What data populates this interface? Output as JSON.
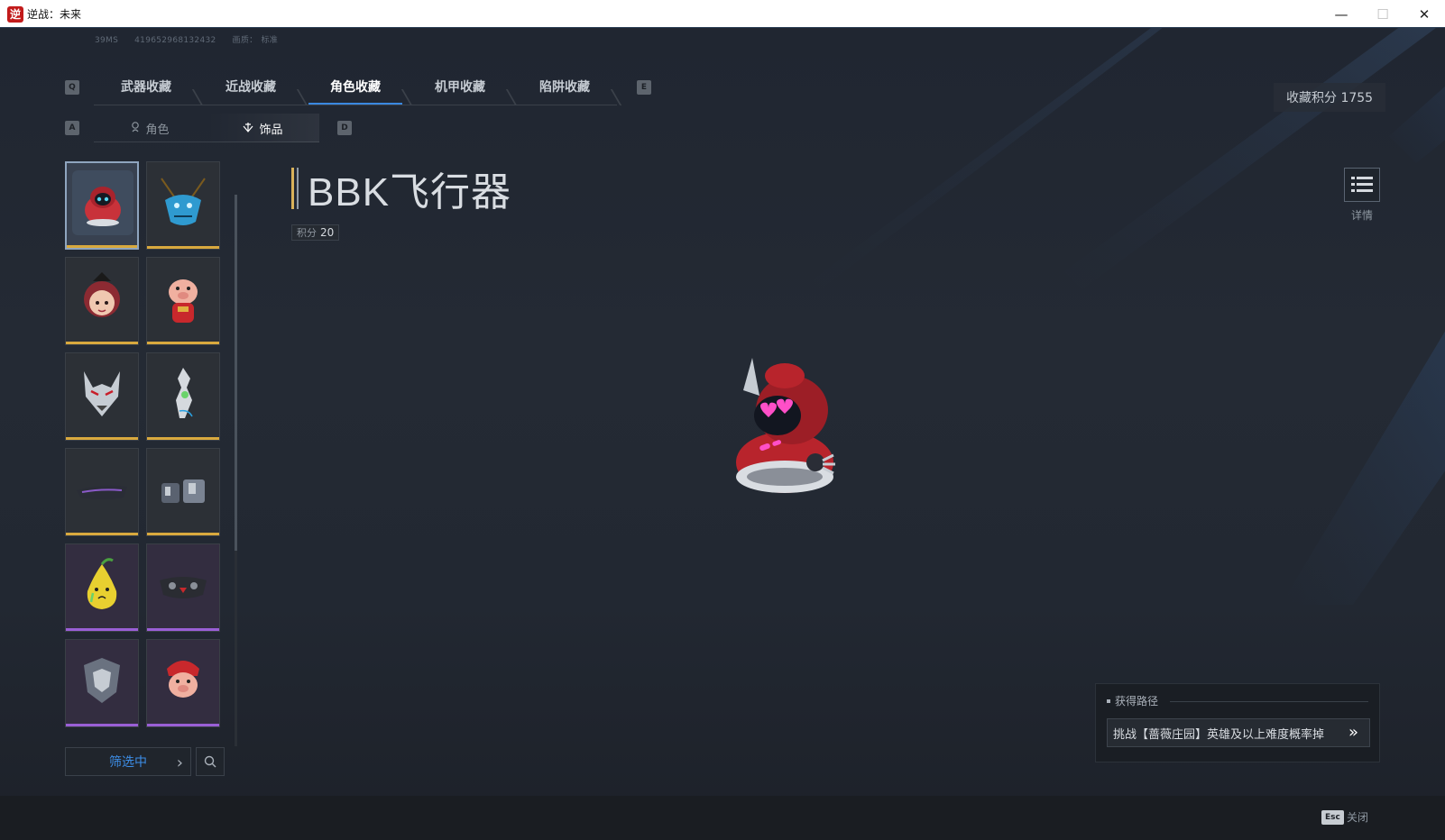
{
  "window": {
    "title": "逆战：未来",
    "minimize": "—",
    "maximize": "☐",
    "close": "✕"
  },
  "netinfo": {
    "ping": "39MS",
    "id": "419652968132432",
    "quality_label": "画质：",
    "quality_value": "标准"
  },
  "key_hints": {
    "prev_tab": "Q",
    "next_tab": "E",
    "prev_sub": "A",
    "next_sub": "D"
  },
  "main_tabs": [
    {
      "label": "武器收藏",
      "active": false
    },
    {
      "label": "近战收藏",
      "active": false
    },
    {
      "label": "角色收藏",
      "active": true
    },
    {
      "label": "机甲收藏",
      "active": false
    },
    {
      "label": "陷阱收藏",
      "active": false
    }
  ],
  "sub_tabs": [
    {
      "label": "角色",
      "icon": "person-icon",
      "active": false
    },
    {
      "label": "饰品",
      "icon": "ornament-icon",
      "active": true
    }
  ],
  "grid_items": [
    {
      "name": "bbk-aircraft",
      "rarity": "gold",
      "selected": true
    },
    {
      "name": "blue-dragon-mask",
      "rarity": "gold",
      "selected": false
    },
    {
      "name": "girl-head",
      "rarity": "gold",
      "selected": false
    },
    {
      "name": "pig-doll",
      "rarity": "gold",
      "selected": false
    },
    {
      "name": "wolf-head",
      "rarity": "gold",
      "selected": false
    },
    {
      "name": "silver-ornament",
      "rarity": "gold",
      "selected": false
    },
    {
      "name": "visor-glasses",
      "rarity": "gold",
      "selected": false
    },
    {
      "name": "mech-parts",
      "rarity": "gold",
      "selected": false
    },
    {
      "name": "pear-character",
      "rarity": "purple",
      "selected": false
    },
    {
      "name": "dark-mask",
      "rarity": "purple",
      "selected": false
    },
    {
      "name": "armor-piece",
      "rarity": "purple",
      "selected": false
    },
    {
      "name": "pig-warrior",
      "rarity": "purple",
      "selected": false
    }
  ],
  "filter": {
    "label": "筛选中",
    "chevron": "›"
  },
  "item": {
    "name": "BBK飞行器",
    "points_label": "积分",
    "points_value": "20"
  },
  "score": {
    "label": "收藏积分 1755"
  },
  "details": {
    "label": "详情"
  },
  "acquisition": {
    "heading": "获得路径",
    "route": "挑战【蔷薇庄园】英雄及以上难度概率掉",
    "arrow": "»"
  },
  "footer": {
    "esc_key": "Esc",
    "close_label": "关闭"
  },
  "colors": {
    "accent_blue": "#3a88e0",
    "gold": "#d9a93e",
    "purple": "#9a5fd6",
    "title_mark": "#d9b25a"
  }
}
